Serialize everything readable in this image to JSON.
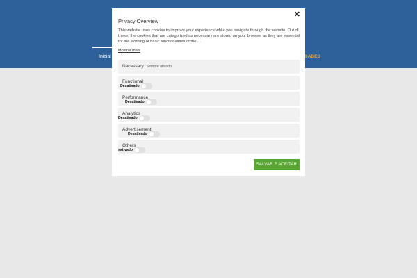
{
  "nav": {
    "item_home": "Inicial",
    "item_right": "DADES"
  },
  "modal": {
    "close_glyph": "✕",
    "title": "Privacy Overview",
    "text": "This website uses cookies to improve your experience while you navigate through the website. Out of these, the cookies that are categorized as necessary are stored on your browser as they are essential for the working of basic functionalities of the ...",
    "show_more": "Mostrar mais",
    "categories": [
      {
        "name": "Necessary",
        "status": "Sempre ativado"
      },
      {
        "name": "Functional",
        "toggle_label": "Desativado"
      },
      {
        "name": "Performance",
        "toggle_label": "Desativado"
      },
      {
        "name": "Analytics",
        "toggle_label": "Desativado"
      },
      {
        "name": "Advertisement",
        "toggle_label": "Desativado"
      },
      {
        "name": "Others",
        "toggle_label": "sativado"
      }
    ],
    "save_label": "SALVAR E ACEITAR"
  },
  "colors": {
    "header": "#2e6199",
    "accent_orange": "#e8a33c",
    "save_button": "#5aa632",
    "page_background": "#e8e8e8"
  }
}
